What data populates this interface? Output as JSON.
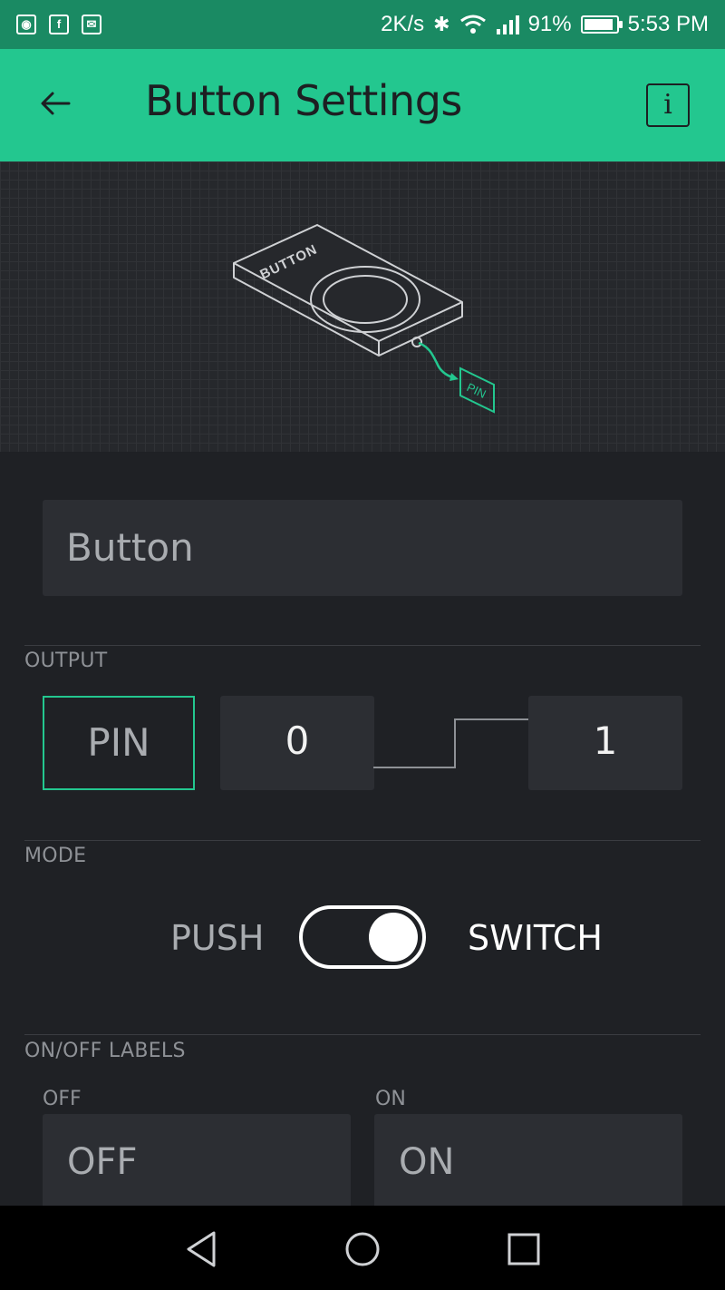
{
  "status_bar": {
    "net_speed": "2K/s",
    "battery_percent": "91%",
    "battery_level": 0.91,
    "time": "5:53 PM",
    "icons": [
      "maps-icon",
      "facebook-icon",
      "gmail-icon",
      "bluetooth-icon",
      "wifi-icon",
      "signal-icon"
    ]
  },
  "app_bar": {
    "title": "Button Settings",
    "back_icon": "arrow-left-icon",
    "info_label": "i"
  },
  "illustration": {
    "device_label": "BUTTON",
    "pin_label": "PIN",
    "accent_color": "#23c78f"
  },
  "form": {
    "name_value": "Button",
    "output": {
      "section_label": "OUTPUT",
      "pin_label": "PIN",
      "low_value": "0",
      "high_value": "1"
    },
    "mode": {
      "section_label": "MODE",
      "push_label": "PUSH",
      "switch_label": "SWITCH",
      "selected": "SWITCH"
    },
    "labels": {
      "section_label": "ON/OFF LABELS",
      "off_caption": "OFF",
      "on_caption": "ON",
      "off_value": "OFF",
      "on_value": "ON"
    }
  },
  "nav_bar": {
    "icons": [
      "back-triangle-icon",
      "home-circle-icon",
      "recents-square-icon"
    ]
  },
  "colors": {
    "accent": "#23c78f",
    "status_bar": "#1a8a63",
    "background": "#1f2125",
    "field": "#2c2e33"
  }
}
